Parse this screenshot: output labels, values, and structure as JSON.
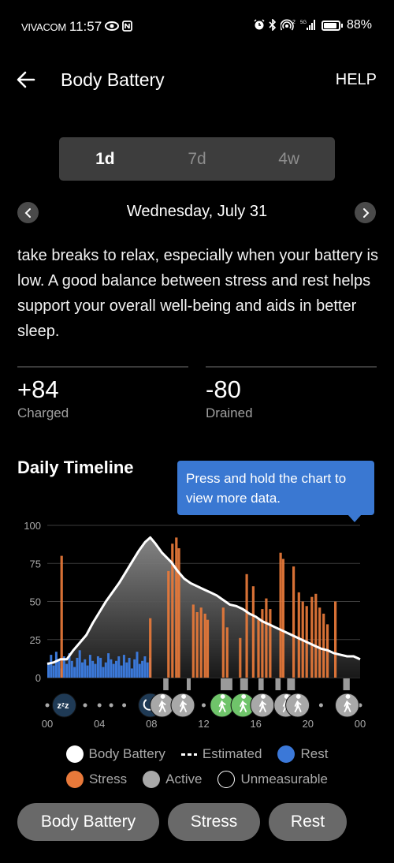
{
  "status_bar": {
    "carrier": "VIVACOM",
    "time": "11:57",
    "battery_percent": "88%",
    "icons": [
      "eye-icon",
      "nfc-icon",
      "alarm-icon",
      "bluetooth-icon",
      "hotspot-icon",
      "5g-signal-icon",
      "battery-icon"
    ],
    "hotspot_count": "2",
    "network": "5G"
  },
  "app_bar": {
    "title": "Body Battery",
    "help_label": "HELP"
  },
  "period_tabs": [
    {
      "label": "1d",
      "active": true
    },
    {
      "label": "7d",
      "active": false
    },
    {
      "label": "4w",
      "active": false
    }
  ],
  "date": "Wednesday, July 31",
  "description": "take breaks to relax, especially when your battery is low. A good balance between stress and rest helps support your overall well-being and aids in better sleep.",
  "stats": {
    "charged": {
      "value": "+84",
      "label": "Charged"
    },
    "drained": {
      "value": "-80",
      "label": "Drained"
    }
  },
  "timeline": {
    "title": "Daily Timeline",
    "tooltip": "Press and hold the chart to view more data."
  },
  "colors": {
    "rest": "#3b78d8",
    "stress": "#e8793a",
    "active": "#a8a8a8",
    "active_highlight": "#6fc46a",
    "tooltip": "#3a78d2",
    "sleep_badge": "#1f3a55"
  },
  "chart_data": {
    "type": "area",
    "title": "Daily Timeline",
    "ylim": [
      0,
      100
    ],
    "yticks": [
      "0",
      "25",
      "50",
      "75",
      "100"
    ],
    "xlim_hours": [
      0,
      24
    ],
    "xticks": [
      "00",
      "04",
      "08",
      "12",
      "16",
      "20",
      "00"
    ],
    "grid": true,
    "series": [
      {
        "name": "Body Battery",
        "kind": "line",
        "x_hours": [
          0,
          0.5,
          1,
          1.5,
          2,
          2.5,
          3,
          3.5,
          4,
          4.5,
          5,
          5.5,
          6,
          6.5,
          7,
          7.5,
          7.9,
          8.3,
          8.8,
          9.5,
          10,
          10.5,
          11,
          11.5,
          12,
          12.5,
          13,
          13.5,
          14,
          14.5,
          15,
          15.5,
          16,
          16.5,
          17,
          17.5,
          18,
          18.5,
          19,
          19.5,
          20,
          20.5,
          21,
          21.5,
          22,
          22.5,
          23,
          23.5,
          24
        ],
        "values": [
          9,
          10,
          12,
          12,
          18,
          23,
          28,
          36,
          43,
          50,
          56,
          62,
          69,
          76,
          83,
          89,
          92,
          88,
          82,
          76,
          70,
          65,
          62,
          60,
          58,
          56,
          54,
          51,
          48,
          47,
          45,
          42,
          40,
          37,
          35,
          33,
          31,
          29,
          27,
          25,
          23,
          21,
          19,
          18,
          16,
          15,
          14,
          14,
          12
        ]
      },
      {
        "name": "Rest",
        "kind": "bars",
        "range_hours": [
          0,
          8
        ],
        "typical_values": [
          10,
          15,
          8,
          17,
          12,
          6,
          14,
          9,
          16,
          11,
          7,
          13,
          18,
          10,
          12,
          8,
          15,
          11,
          9,
          14,
          13,
          7,
          10,
          16,
          12,
          9,
          11,
          14,
          8,
          15,
          10,
          13,
          6,
          12,
          17,
          9,
          11,
          14,
          10,
          13
        ]
      },
      {
        "name": "Stress",
        "kind": "bars",
        "events": [
          {
            "hour": 1.1,
            "value": 80
          },
          {
            "hour": 7.9,
            "value": 39
          },
          {
            "hour": 9.3,
            "value": 70
          },
          {
            "hour": 9.6,
            "value": 88
          },
          {
            "hour": 9.9,
            "value": 92
          },
          {
            "hour": 10.1,
            "value": 85
          },
          {
            "hour": 11.2,
            "value": 48
          },
          {
            "hour": 11.5,
            "value": 43
          },
          {
            "hour": 11.8,
            "value": 46
          },
          {
            "hour": 12.1,
            "value": 42
          },
          {
            "hour": 12.3,
            "value": 38
          },
          {
            "hour": 13.5,
            "value": 46
          },
          {
            "hour": 13.8,
            "value": 33
          },
          {
            "hour": 14.8,
            "value": 26
          },
          {
            "hour": 15.3,
            "value": 68
          },
          {
            "hour": 15.8,
            "value": 60
          },
          {
            "hour": 16.2,
            "value": 38
          },
          {
            "hour": 16.5,
            "value": 45
          },
          {
            "hour": 16.8,
            "value": 52
          },
          {
            "hour": 17.1,
            "value": 45
          },
          {
            "hour": 17.9,
            "value": 82
          },
          {
            "hour": 18.1,
            "value": 78
          },
          {
            "hour": 18.9,
            "value": 73
          },
          {
            "hour": 19.3,
            "value": 56
          },
          {
            "hour": 19.6,
            "value": 50
          },
          {
            "hour": 19.9,
            "value": 47
          },
          {
            "hour": 20.3,
            "value": 53
          },
          {
            "hour": 20.6,
            "value": 55
          },
          {
            "hour": 20.9,
            "value": 46
          },
          {
            "hour": 21.2,
            "value": 42
          },
          {
            "hour": 21.5,
            "value": 35
          },
          {
            "hour": 22.1,
            "value": 50
          }
        ]
      },
      {
        "name": "Active",
        "kind": "segments",
        "ranges_hours": [
          [
            8.9,
            9.3
          ],
          [
            10.7,
            11.0
          ],
          [
            13.3,
            14.2
          ],
          [
            14.8,
            15.4
          ],
          [
            16.2,
            16.6
          ],
          [
            17.5,
            17.9
          ],
          [
            18.4,
            19.0
          ],
          [
            22.7,
            23.2
          ]
        ]
      }
    ],
    "event_markers": [
      {
        "hour": 1.3,
        "type": "sleep",
        "icon": "sleep-zzz-icon"
      },
      {
        "hour": 7.9,
        "type": "wake",
        "icon": "alarm-icon"
      },
      {
        "hour": 8.8,
        "type": "active",
        "icon": "walking-icon"
      },
      {
        "hour": 10.4,
        "type": "active",
        "icon": "walking-icon"
      },
      {
        "hour": 13.4,
        "type": "active-highlight",
        "icon": "walking-icon"
      },
      {
        "hour": 15.0,
        "type": "active-highlight",
        "icon": "walking-icon"
      },
      {
        "hour": 16.5,
        "type": "active",
        "icon": "walking-icon"
      },
      {
        "hour": 18.3,
        "type": "active",
        "icon": "walking-icon"
      },
      {
        "hour": 19.2,
        "type": "active",
        "icon": "walking-icon"
      },
      {
        "hour": 23.0,
        "type": "active",
        "icon": "walking-icon"
      }
    ],
    "dots_hours": [
      0,
      2.9,
      4,
      4.9,
      5.9,
      12,
      21,
      24
    ]
  },
  "legend": [
    {
      "label": "Body Battery",
      "swatch": "dot",
      "color": "#ffffff"
    },
    {
      "label": "Estimated",
      "swatch": "dash",
      "color": "#ffffff"
    },
    {
      "label": "Rest",
      "swatch": "dot",
      "color": "#3b78d8"
    },
    {
      "label": "Stress",
      "swatch": "dot",
      "color": "#e8793a"
    },
    {
      "label": "Active",
      "swatch": "dot",
      "color": "#a8a8a8"
    },
    {
      "label": "Unmeasurable",
      "swatch": "ring",
      "color": "#ffffff"
    }
  ],
  "filters": [
    {
      "label": "Body Battery"
    },
    {
      "label": "Stress"
    },
    {
      "label": "Rest"
    }
  ]
}
